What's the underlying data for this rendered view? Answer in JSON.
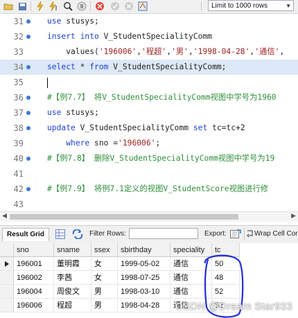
{
  "toolbar": {
    "icons": [
      "folder-open-icon",
      "save-icon",
      "flash-icon",
      "flash-cursor-icon",
      "inspect-icon",
      "hand-stop-icon",
      "clear-search-icon",
      "commit-check-icon",
      "cancel-icon",
      "auto-commit-icon"
    ],
    "limit_select": "Limit to 1000 rows"
  },
  "editor": {
    "lines": [
      {
        "num": "31",
        "dot": true,
        "hl": false,
        "parts": [
          [
            "kw",
            "use"
          ],
          [
            "t",
            " stusys;"
          ]
        ]
      },
      {
        "num": "32",
        "dot": true,
        "hl": false,
        "parts": [
          [
            "kw",
            "insert into"
          ],
          [
            "t",
            " V_StudentSpecialityComm"
          ]
        ]
      },
      {
        "num": "33",
        "dot": false,
        "hl": false,
        "parts": [
          [
            "t",
            "    values("
          ],
          [
            "str",
            "'196006'"
          ],
          [
            "t",
            ","
          ],
          [
            "str",
            "'程超'"
          ],
          [
            "t",
            ","
          ],
          [
            "str",
            "'男'"
          ],
          [
            "t",
            ","
          ],
          [
            "str",
            "'1998-04-28'"
          ],
          [
            "t",
            ","
          ],
          [
            "str",
            "'通信'"
          ],
          [
            "t",
            ","
          ]
        ]
      },
      {
        "num": "34",
        "dot": true,
        "hl": true,
        "parts": [
          [
            "kw",
            "select"
          ],
          [
            "t",
            " * "
          ],
          [
            "kw",
            "from"
          ],
          [
            "t",
            " V_StudentSpecialityComm;"
          ]
        ]
      },
      {
        "num": "35",
        "dot": false,
        "hl": false,
        "caret": true,
        "parts": []
      },
      {
        "num": "36",
        "dot": true,
        "hl": false,
        "parts": [
          [
            "cmt",
            "#【例7.7】 将V_StudentSpecialityComm视图中学号为1960"
          ]
        ]
      },
      {
        "num": "37",
        "dot": true,
        "hl": false,
        "parts": [
          [
            "kw",
            "use"
          ],
          [
            "t",
            " stusys;"
          ]
        ]
      },
      {
        "num": "38",
        "dot": true,
        "hl": false,
        "parts": [
          [
            "kw",
            "update"
          ],
          [
            "t",
            " V_StudentSpecialityComm "
          ],
          [
            "kw",
            "set"
          ],
          [
            "t",
            " tc=tc+2"
          ]
        ]
      },
      {
        "num": "39",
        "dot": false,
        "hl": false,
        "parts": [
          [
            "t",
            "    "
          ],
          [
            "kw",
            "where"
          ],
          [
            "t",
            " sno ="
          ],
          [
            "str",
            "'196006'"
          ],
          [
            "t",
            ";"
          ]
        ]
      },
      {
        "num": "40",
        "dot": true,
        "hl": false,
        "parts": [
          [
            "cmt",
            "#【例7.8】 删除V_StudentSpecialityComm视图中学号为19"
          ]
        ]
      },
      {
        "num": "41",
        "dot": false,
        "hl": false,
        "parts": []
      },
      {
        "num": "42",
        "dot": true,
        "hl": false,
        "parts": [
          [
            "cmt",
            "#【例7.9】 将例7.1定义的视图V_StudentScore视图进行修"
          ]
        ]
      },
      {
        "num": "43",
        "dot": false,
        "hl": false,
        "parts": []
      }
    ]
  },
  "results": {
    "tab_label": "Result Grid",
    "filter_label": "Filter Rows:",
    "export_label": "Export:",
    "wrap_label": "Wrap Cell Cor",
    "columns": [
      "sno",
      "sname",
      "ssex",
      "sbirthday",
      "speciality",
      "tc"
    ],
    "rows": [
      [
        "196001",
        "董明霞",
        "女",
        "1999-05-02",
        "通信",
        "50"
      ],
      [
        "196002",
        "李茜",
        "女",
        "1998-07-25",
        "通信",
        "48"
      ],
      [
        "196004",
        "周俊文",
        "男",
        "1998-03-10",
        "通信",
        "52"
      ],
      [
        "196006",
        "程超",
        "男",
        "1998-04-28",
        "通信",
        "52"
      ]
    ],
    "current_row": 0
  },
  "annotation": {
    "color": "#1f2fd8",
    "target_column": "tc"
  },
  "watermark": "CSDN @Dream Star933"
}
